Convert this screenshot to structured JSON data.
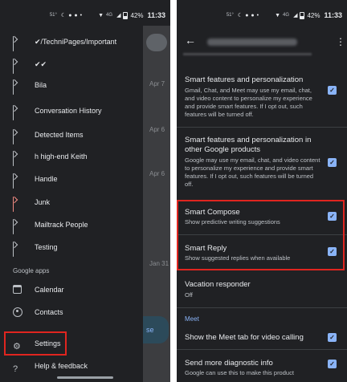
{
  "status_bar": {
    "left_text": "51°",
    "network": "4G",
    "battery": "42%",
    "time": "11:33"
  },
  "left": {
    "labels": [
      {
        "text": "✔/TechniPages/Important"
      },
      {
        "text": "✔✔"
      },
      {
        "text": "Bila"
      },
      {
        "text": "Conversation History"
      },
      {
        "text": "Detected Items"
      },
      {
        "text": "h high-end Keith"
      },
      {
        "text": "Handle"
      },
      {
        "text": "Junk",
        "color": "#f28b82"
      },
      {
        "text": "Mailtrack People"
      },
      {
        "text": "Testing"
      }
    ],
    "google_apps_heading": "Google apps",
    "calendar": "Calendar",
    "contacts": "Contacts",
    "settings": "Settings",
    "help": "Help & feedback",
    "inbox_dates": [
      "Apr 7",
      "Apr 6",
      "Apr 6",
      "Jan 31"
    ],
    "fab_label": "se",
    "highlight_color": "#e0251f"
  },
  "right": {
    "settings": [
      {
        "title": "Smart features and personalization",
        "desc": "Gmail, Chat, and Meet may use my email, chat, and video content to personalize my experience and provide smart features. If I opt out, such features will be turned off.",
        "checked": true
      },
      {
        "title": "Smart features and personalization in other Google products",
        "desc": "Google may use my email, chat, and video content to personalize my experience and provide smart features. If I opt out, such features will be turned off.",
        "checked": true
      },
      {
        "title": "Smart Compose",
        "desc": "Show predictive writing suggestions",
        "checked": true
      },
      {
        "title": "Smart Reply",
        "desc": "Show suggested replies when available",
        "checked": true
      },
      {
        "title": "Vacation responder",
        "desc": "Off",
        "checked": false
      }
    ],
    "meet_heading": "Meet",
    "meet_tab": "Show the Meet tab for video calling",
    "diag_title": "Send more diagnostic info",
    "diag_desc": "Google can use this to make this product",
    "accent_color": "#8ab4f8"
  }
}
